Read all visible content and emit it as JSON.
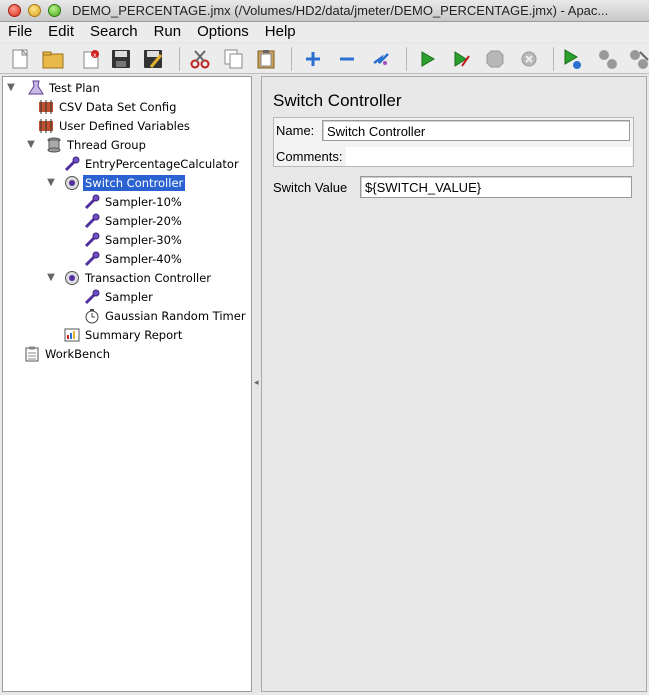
{
  "window": {
    "title": "DEMO_PERCENTAGE.jmx (/Volumes/HD2/data/jmeter/DEMO_PERCENTAGE.jmx) - Apac..."
  },
  "menu": [
    "File",
    "Edit",
    "Search",
    "Run",
    "Options",
    "Help"
  ],
  "toolbar": {
    "icons": [
      "new-icon",
      "open-icon",
      "close-icon",
      "save-icon",
      "save-as-icon",
      "cut-icon",
      "copy-icon",
      "paste-icon",
      "expand-icon",
      "collapse-icon",
      "toggle-icon",
      "start-icon",
      "start-no-pauses-icon",
      "stop-icon",
      "shutdown-icon",
      "remote-start-icon",
      "remote-stop-icon",
      "remote-shutdown-icon"
    ]
  },
  "tree": {
    "nodes": [
      {
        "label": "Test Plan",
        "icon": "test-plan-icon"
      },
      {
        "label": "CSV Data Set Config",
        "icon": "config-icon"
      },
      {
        "label": "User Defined Variables",
        "icon": "config-icon"
      },
      {
        "label": "Thread Group",
        "icon": "thread-group-icon"
      },
      {
        "label": "EntryPercentageCalculator",
        "icon": "sampler-icon"
      },
      {
        "label": "Switch Controller",
        "icon": "controller-icon"
      },
      {
        "label": "Sampler-10%",
        "icon": "sampler-icon"
      },
      {
        "label": "Sampler-20%",
        "icon": "sampler-icon"
      },
      {
        "label": "Sampler-30%",
        "icon": "sampler-icon"
      },
      {
        "label": "Sampler-40%",
        "icon": "sampler-icon"
      },
      {
        "label": "Transaction Controller",
        "icon": "controller-icon"
      },
      {
        "label": "Sampler",
        "icon": "sampler-icon"
      },
      {
        "label": "Gaussian Random Timer",
        "icon": "timer-icon"
      },
      {
        "label": "Summary Report",
        "icon": "listener-icon"
      },
      {
        "label": "WorkBench",
        "icon": "workbench-icon"
      }
    ]
  },
  "editor": {
    "title": "Switch Controller",
    "name_label": "Name:",
    "name_value": "Switch Controller",
    "comments_label": "Comments:",
    "comments_value": "",
    "switch_label": "Switch Value",
    "switch_value": "${SWITCH_VALUE}"
  }
}
